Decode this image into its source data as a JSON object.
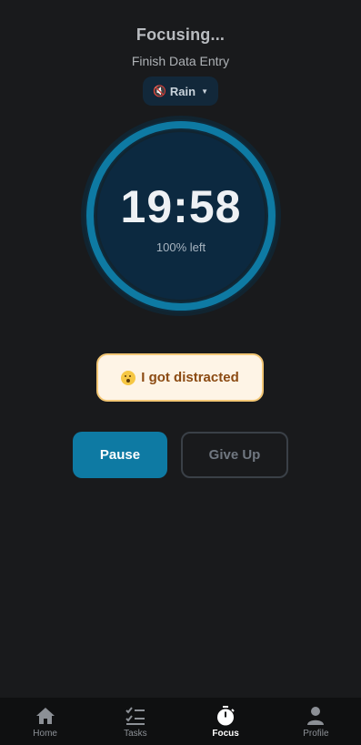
{
  "header": {
    "title": "Focusing...",
    "task_name": "Finish Data Entry"
  },
  "sound": {
    "icon": "muted-speaker-icon",
    "label": "Rain"
  },
  "timer": {
    "time": "19:58",
    "remaining_label": "100% left",
    "progress_fraction": 1.0
  },
  "actions": {
    "distracted_label": "I got distracted",
    "pause_label": "Pause",
    "give_up_label": "Give Up"
  },
  "tabs": [
    {
      "label": "Home",
      "icon": "home-icon"
    },
    {
      "label": "Tasks",
      "icon": "tasks-icon"
    },
    {
      "label": "Focus",
      "icon": "stopwatch-icon"
    },
    {
      "label": "Profile",
      "icon": "profile-icon"
    }
  ],
  "colors": {
    "accent": "#0e7aa3",
    "background": "#191a1c",
    "distracted_bg": "#fef4e6",
    "distracted_border": "#f3c775"
  }
}
